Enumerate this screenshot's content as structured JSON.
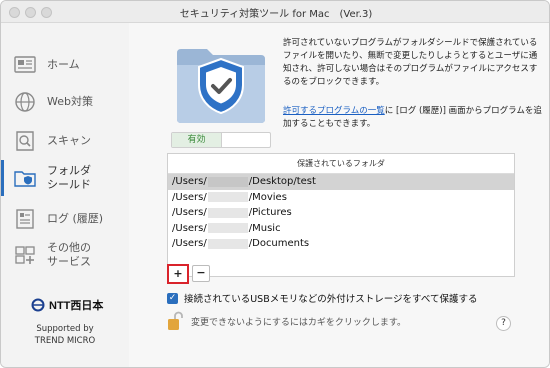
{
  "window": {
    "title": "セキュリティ対策ツール for Mac　(Ver.3)"
  },
  "sidebar": {
    "items": [
      {
        "label": "ホーム",
        "icon": "home-icon"
      },
      {
        "label": "Web対策",
        "icon": "globe-icon"
      },
      {
        "label": "スキャン",
        "icon": "scan-icon"
      },
      {
        "label": "フォルダ\nシールド",
        "icon": "folder-shield-icon",
        "active": true
      },
      {
        "label": "ログ (履歴)",
        "icon": "log-icon"
      },
      {
        "label": "その他の\nサービス",
        "icon": "services-icon"
      }
    ],
    "brand": "NTT西日本",
    "supported_by": [
      "Supported by",
      "TREND MICRO"
    ]
  },
  "main": {
    "description": "許可されていないプログラムがフォルダシールドで保護されているファイルを開いたり、無断で変更したりしようとするとユーザに通知され、許可しない場合はそのプログラムがファイルにアクセスするのをブロックできます。",
    "link_text": "許可するプログラムの一覧",
    "link_suffix": "に [ログ (履歴)] 画面からプログラムを追加することもできます。",
    "toggle_on_label": "有効",
    "table_header": "保護されているフォルダ",
    "folders": [
      {
        "prefix": "/Users/",
        "suffix": "/Desktop/test",
        "selected": true
      },
      {
        "prefix": "/Users/",
        "suffix": "/Movies"
      },
      {
        "prefix": "/Users/",
        "suffix": "/Pictures"
      },
      {
        "prefix": "/Users/",
        "suffix": "/Music"
      },
      {
        "prefix": "/Users/",
        "suffix": "/Documents"
      }
    ],
    "add_label": "+",
    "remove_label": "−",
    "usb_checkbox_label": "接続されているUSBメモリなどの外付けストレージをすべて保護する",
    "lock_text": "変更できないようにするにはカギをクリックします。",
    "help_label": "?"
  },
  "colors": {
    "accent": "#2a6ebd",
    "highlight_red": "#d9232b",
    "toggle_green": "#3a8a3a"
  }
}
